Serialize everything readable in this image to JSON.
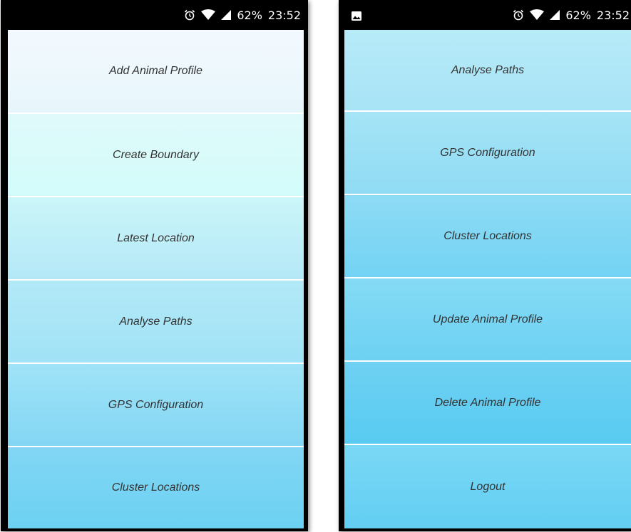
{
  "status_bar": {
    "battery": "62%",
    "time": "23:52",
    "icons": [
      "alarm-icon",
      "wifi-icon",
      "signal-icon"
    ],
    "notification_icon": "image-notification-icon"
  },
  "left_screen": {
    "menu": [
      {
        "label": "Add Animal Profile"
      },
      {
        "label": "Create Boundary"
      },
      {
        "label": "Latest Location"
      },
      {
        "label": "Analyse Paths"
      },
      {
        "label": "GPS Configuration"
      },
      {
        "label": "Cluster Locations"
      }
    ]
  },
  "right_screen": {
    "menu": [
      {
        "label": "Analyse Paths"
      },
      {
        "label": "GPS Configuration"
      },
      {
        "label": "Cluster Locations"
      },
      {
        "label": "Update Animal Profile"
      },
      {
        "label": "Delete Animal Profile"
      },
      {
        "label": "Logout"
      }
    ]
  },
  "colors": {
    "phone_frame": "#000000",
    "separator": "#ffffff",
    "text": "#333333",
    "left_gradient": [
      "#f3f9fe",
      "#e7f6fb",
      "#e0fafb",
      "#d2fcfa",
      "#cbf6f9",
      "#b4e8f7",
      "#b3e9f7",
      "#a0e2f6",
      "#a0e3f7",
      "#83d6f4",
      "#82d6f4",
      "#6cd1f2"
    ],
    "right_gradient": [
      "#b7ebf8",
      "#a7e3f6",
      "#a5e4f6",
      "#90dbf4",
      "#8edbf5",
      "#73d3f3",
      "#85dbf5",
      "#6dd1f2",
      "#6fd1f3",
      "#58cbf1",
      "#7ad8f5",
      "#62cef2"
    ]
  }
}
